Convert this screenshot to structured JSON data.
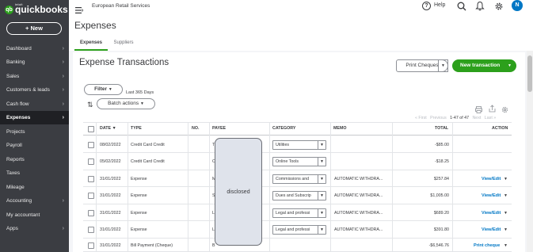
{
  "sidebar": {
    "logo_small": "intuit",
    "logo_text": "quickbooks",
    "new_label": "+ New",
    "items": [
      {
        "label": "Dashboard",
        "chevron": true
      },
      {
        "label": "Banking",
        "chevron": true
      },
      {
        "label": "Sales",
        "chevron": true
      },
      {
        "label": "Customers & leads",
        "chevron": true
      },
      {
        "label": "Cash flow",
        "chevron": true
      },
      {
        "label": "Expenses",
        "chevron": true,
        "active": true
      },
      {
        "label": "Projects",
        "chevron": false
      },
      {
        "label": "Payroll",
        "chevron": false
      },
      {
        "label": "Reports",
        "chevron": false
      },
      {
        "label": "Taxes",
        "chevron": false
      },
      {
        "label": "Mileage",
        "chevron": false
      },
      {
        "label": "Accounting",
        "chevron": true
      },
      {
        "label": "My accountant",
        "chevron": false
      },
      {
        "label": "Apps",
        "chevron": true
      }
    ]
  },
  "topbar": {
    "company": "European Retail Services",
    "help": "Help",
    "avatar": "N"
  },
  "header": {
    "title": "Expenses",
    "tabs": [
      "Expenses",
      "Suppliers"
    ]
  },
  "card": {
    "title": "Expense Transactions",
    "print_cheques": "Print Cheques",
    "new_transaction": "New transaction",
    "filter": "Filter",
    "date_range": "Last 365 Days",
    "batch_actions": "Batch actions",
    "pagination": {
      "first": "« First",
      "previous": "Previous",
      "range": "1-47 of 47",
      "next": "Next",
      "last": "Last »"
    }
  },
  "table": {
    "headers": [
      "DATE ▼",
      "TYPE",
      "NO.",
      "PAYEE",
      "CATEGORY",
      "MEMO",
      "TOTAL",
      "ACTION"
    ],
    "rows": [
      {
        "date": "08/02/2022",
        "type": "Credit Card Credit",
        "payee": "T",
        "category": "Utilities",
        "memo": "",
        "total": "-$85.00",
        "action": "",
        "caret": false
      },
      {
        "date": "05/02/2022",
        "type": "Credit Card Credit",
        "payee": "C",
        "category": "Online Tools",
        "memo": "",
        "total": "-$18.25",
        "action": "",
        "caret": false
      },
      {
        "date": "31/01/2022",
        "type": "Expense",
        "payee": "M",
        "category": "Commissions and",
        "memo": "AUTOMATIC WITHDRA...",
        "total": "$257.84",
        "action": "View/Edit",
        "caret": true
      },
      {
        "date": "31/01/2022",
        "type": "Expense",
        "payee": "S",
        "category": "Dues and Subscrip",
        "memo": "AUTOMATIC WITHDRA...",
        "total": "$1,005.00",
        "action": "View/Edit",
        "caret": true
      },
      {
        "date": "31/01/2022",
        "type": "Expense",
        "payee": "L",
        "category": "Legal and professi",
        "memo": "AUTOMATIC WITHDRA...",
        "total": "$689.20",
        "action": "View/Edit",
        "caret": true
      },
      {
        "date": "31/01/2022",
        "type": "Expense",
        "payee": "L",
        "category": "Legal and professi",
        "memo": "AUTOMATIC WITHDRA...",
        "total": "$391.80",
        "action": "View/Edit",
        "caret": true
      },
      {
        "date": "31/01/2022",
        "type": "Bill Payment (Cheque)",
        "payee": "B",
        "category": "",
        "memo": "",
        "total": "-$6,546.76",
        "action": "Print cheque",
        "caret": true
      }
    ]
  },
  "overlay": {
    "label": "disclosed"
  },
  "colors": {
    "brand_green": "#2ca01c",
    "sidebar_bg": "#3b3d42",
    "link_blue": "#0077c5"
  }
}
